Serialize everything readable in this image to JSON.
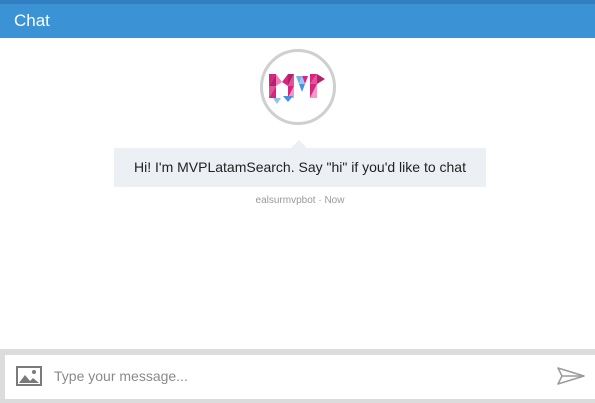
{
  "header": {
    "title": "Chat"
  },
  "bot": {
    "avatar_logo_text": "MVP",
    "message": "Hi! I'm MVPLatamSearch. Say \"hi\" if you'd like to chat",
    "sender": "ealsurmvpbot",
    "separator": "·",
    "time": "Now"
  },
  "composer": {
    "placeholder": "Type your message...",
    "image_icon": "image-upload-icon",
    "send_icon": "send-icon"
  },
  "colors": {
    "header": "#3b92d4",
    "bubble": "#eceff3",
    "logo_pink": "#d6247f",
    "logo_blue": "#4a90e2"
  }
}
